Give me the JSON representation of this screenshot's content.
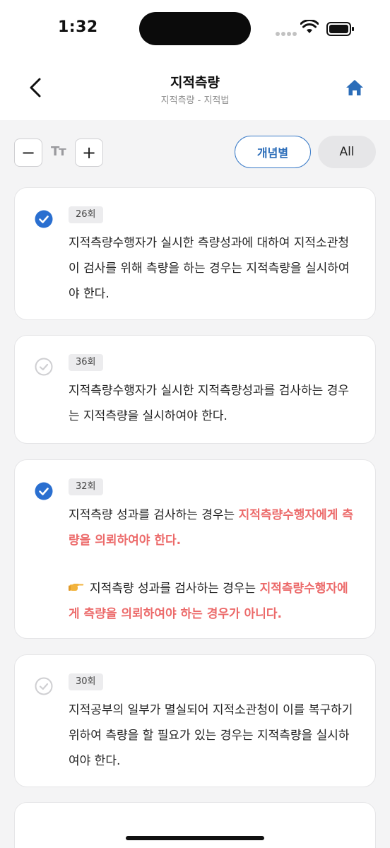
{
  "status_bar": {
    "time": "1:32"
  },
  "header": {
    "title": "지적측량",
    "subtitle": "지적측량 - 지적법"
  },
  "toolbar": {
    "decrease_label": "−",
    "font_size_label": "Tт",
    "increase_label": "+",
    "concept_label": "개념별",
    "all_label": "All"
  },
  "cards": [
    {
      "badge": "26회",
      "checked": true,
      "text": "지적측량수행자가 실시한 측량성과에 대하여 지적소관청이 검사를 위해 측량을 하는 경우는 지적측량을 실시하여야 한다."
    },
    {
      "badge": "36회",
      "checked": false,
      "text": "지적측량수행자가 실시한 지적측량성과를 검사하는 경우는 지적측량을 실시하여야 한다."
    },
    {
      "badge": "32회",
      "checked": true,
      "text_plain": "지적측량 성과를 검사하는 경우는 ",
      "text_highlight": "지적측량수행자에게 측량을 의뢰하여야 한다.",
      "point_icon": "pointing-hand-icon",
      "point_plain": "지적측량 성과를 검사하는 경우는 ",
      "point_highlight": "지적측량수행자에게 측량을 의뢰하여야 하는 경우가 아니다."
    },
    {
      "badge": "30회",
      "checked": false,
      "text": "지적공부의 일부가 멸실되어 지적소관청이 이를 복구하기 위하여 측량을 할 필요가 있는 경우는 지적측량을 실시하여야 한다."
    }
  ],
  "colors": {
    "accent": "#2b6db9",
    "check_on": "#2a6fd0",
    "highlight": "#ec6a6a"
  }
}
